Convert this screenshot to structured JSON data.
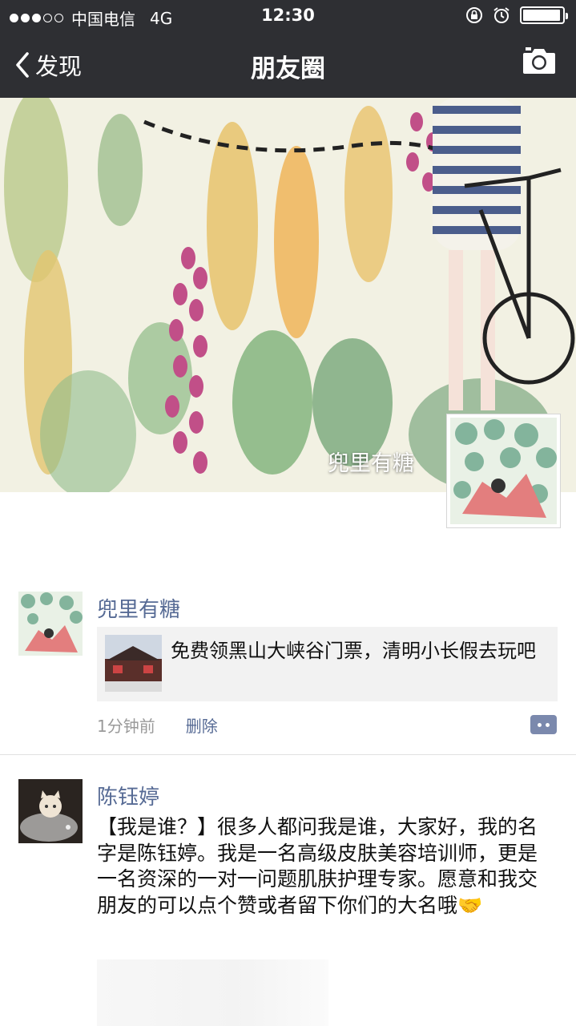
{
  "status_bar": {
    "carrier": "中国电信",
    "network": "4G",
    "time": "12:30",
    "battery_level": 0.95,
    "signal_dots_filled": 3,
    "signal_dots_total": 5
  },
  "nav": {
    "back_label": "发现",
    "title": "朋友圈"
  },
  "cover": {
    "owner_name": "兜里有糖"
  },
  "posts": [
    {
      "author": "兜里有糖",
      "share_text": "免费领黑山大峡谷门票，清明小长假去玩吧",
      "time": "1分钟前",
      "delete_label": "删除"
    },
    {
      "author": "陈钰婷",
      "text": "【我是谁？】很多人都问我是谁，大家好，我的名字是陈钰婷。我是一名高级皮肤美容培训师，更是一名资深的一对一问题肌肤护理专家。愿意和我交朋友的可以点个赞或者留下你们的大名哦🤝"
    }
  ],
  "colors": {
    "bar_bg": "#2e2f33",
    "nickname": "#576b95",
    "meta_gray": "#9a9a9a",
    "share_bg": "#f2f2f2"
  },
  "icons": [
    "back-chevron-icon",
    "camera-icon",
    "alarm-icon",
    "rotation-lock-icon",
    "comment-icon"
  ]
}
